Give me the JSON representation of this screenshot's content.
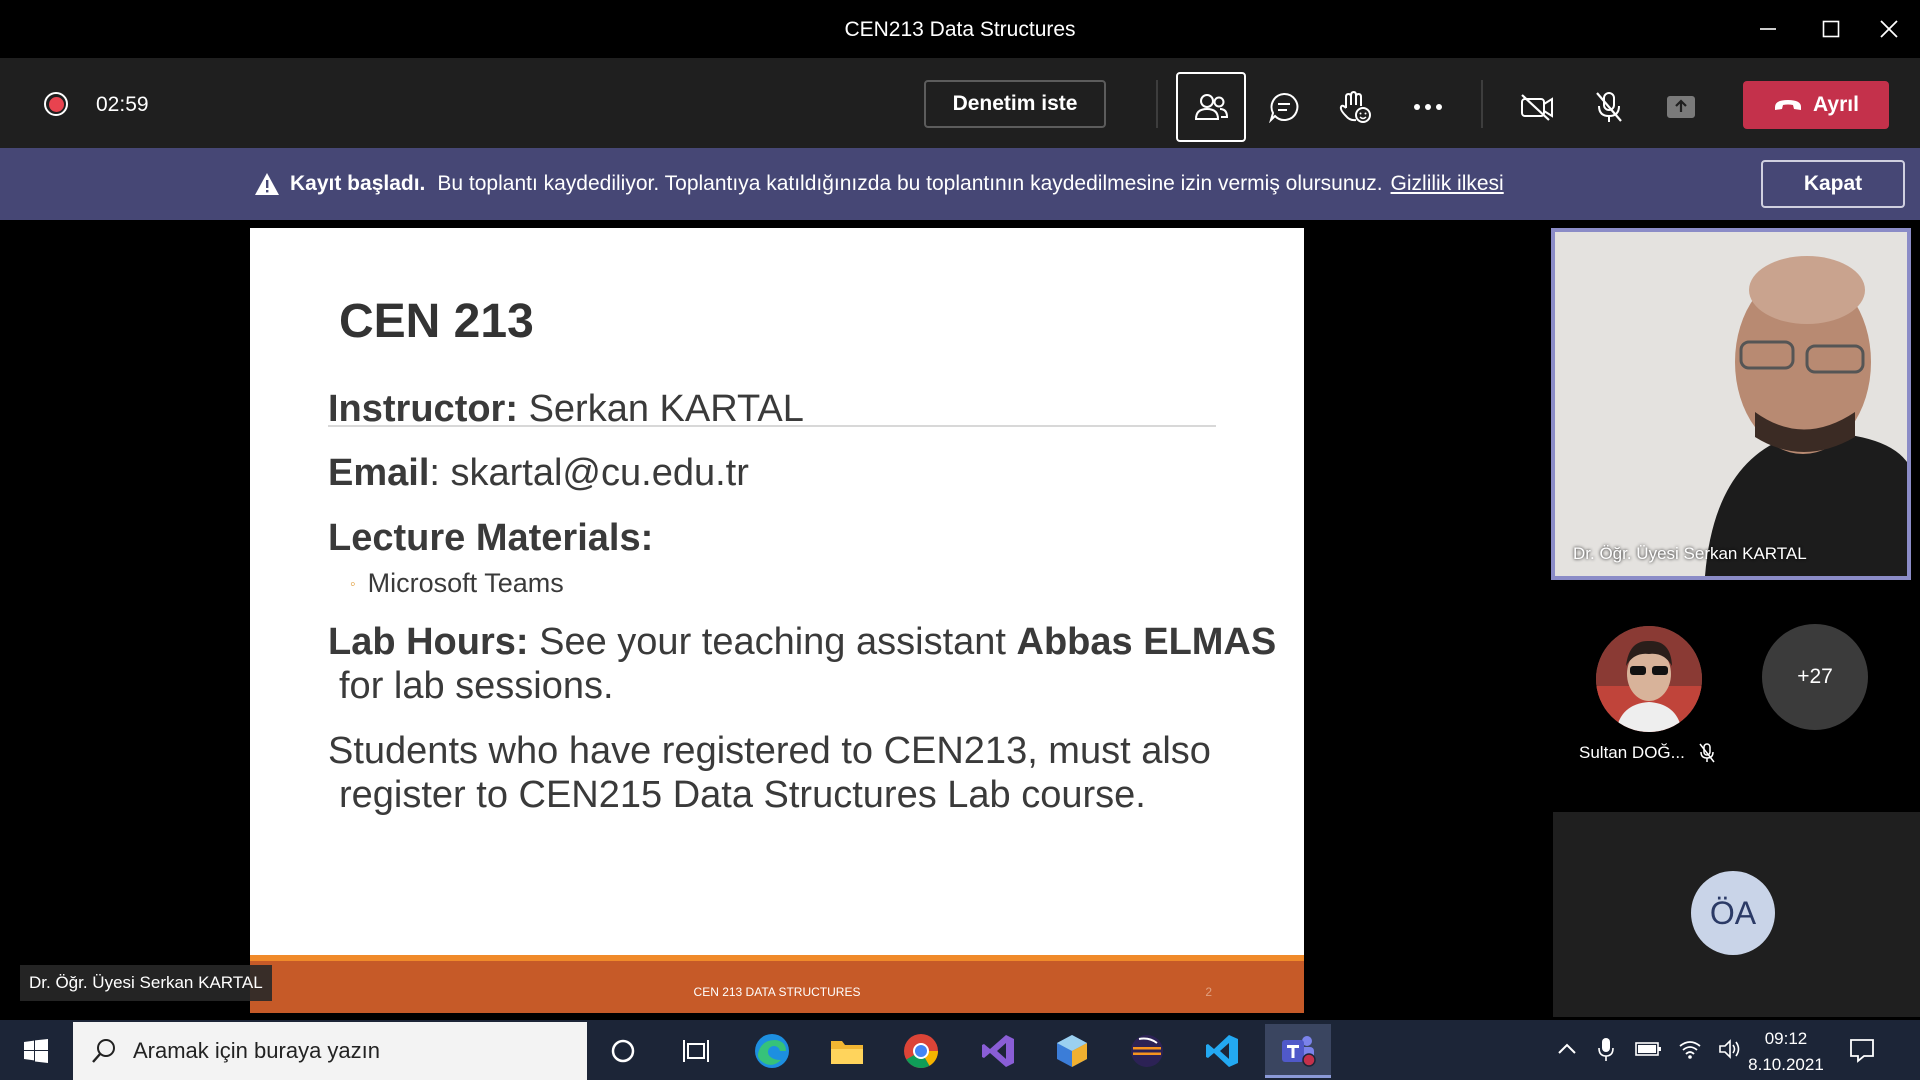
{
  "window": {
    "title": "CEN213 Data Structures"
  },
  "toolbar": {
    "timer": "02:59",
    "request_control_label": "Denetim iste",
    "leave_label": "Ayrıl"
  },
  "banner": {
    "bold": "Kayıt başladı.",
    "message": "Bu toplantı kaydediliyor. Toplantıya katıldığınızda bu toplantının kaydedilmesine izin vermiş olursunuz.",
    "link": "Gizlilik ilkesi",
    "close_label": "Kapat"
  },
  "slide": {
    "title": "CEN 213",
    "instructor_label": "Instructor:",
    "instructor_value": "Serkan KARTAL",
    "email_label": "Email",
    "email_value": ": skartal@cu.edu.tr",
    "materials_label": "Lecture Materials:",
    "materials_bullet": "Microsoft Teams",
    "lab_label": "Lab Hours:",
    "lab_text": "See your teaching assistant",
    "lab_ta": "Abbas ELMAS",
    "lab_text2": "for lab sessions.",
    "note_line1": "Students who have registered to CEN213, must also",
    "note_line2": "register to CEN215 Data Structures Lab course.",
    "footer": "CEN 213 DATA STRUCTURES",
    "page_number": "2"
  },
  "presenter_name": "Dr. Öğr. Üyesi Serkan KARTAL",
  "participants": {
    "video_name": "Dr. Öğr. Üyesi Serkan KARTAL",
    "attendee_name": "Sultan DOĞ...",
    "more_count": "+27",
    "initials": "ÖA"
  },
  "taskbar": {
    "search_placeholder": "Aramak için buraya yazın",
    "time": "09:12",
    "date": "8.10.2021"
  },
  "colors": {
    "leave": "#c4314b",
    "banner": "#464775",
    "active_tile_border": "#8b8cc7",
    "slide_footer": "#c65a28"
  }
}
